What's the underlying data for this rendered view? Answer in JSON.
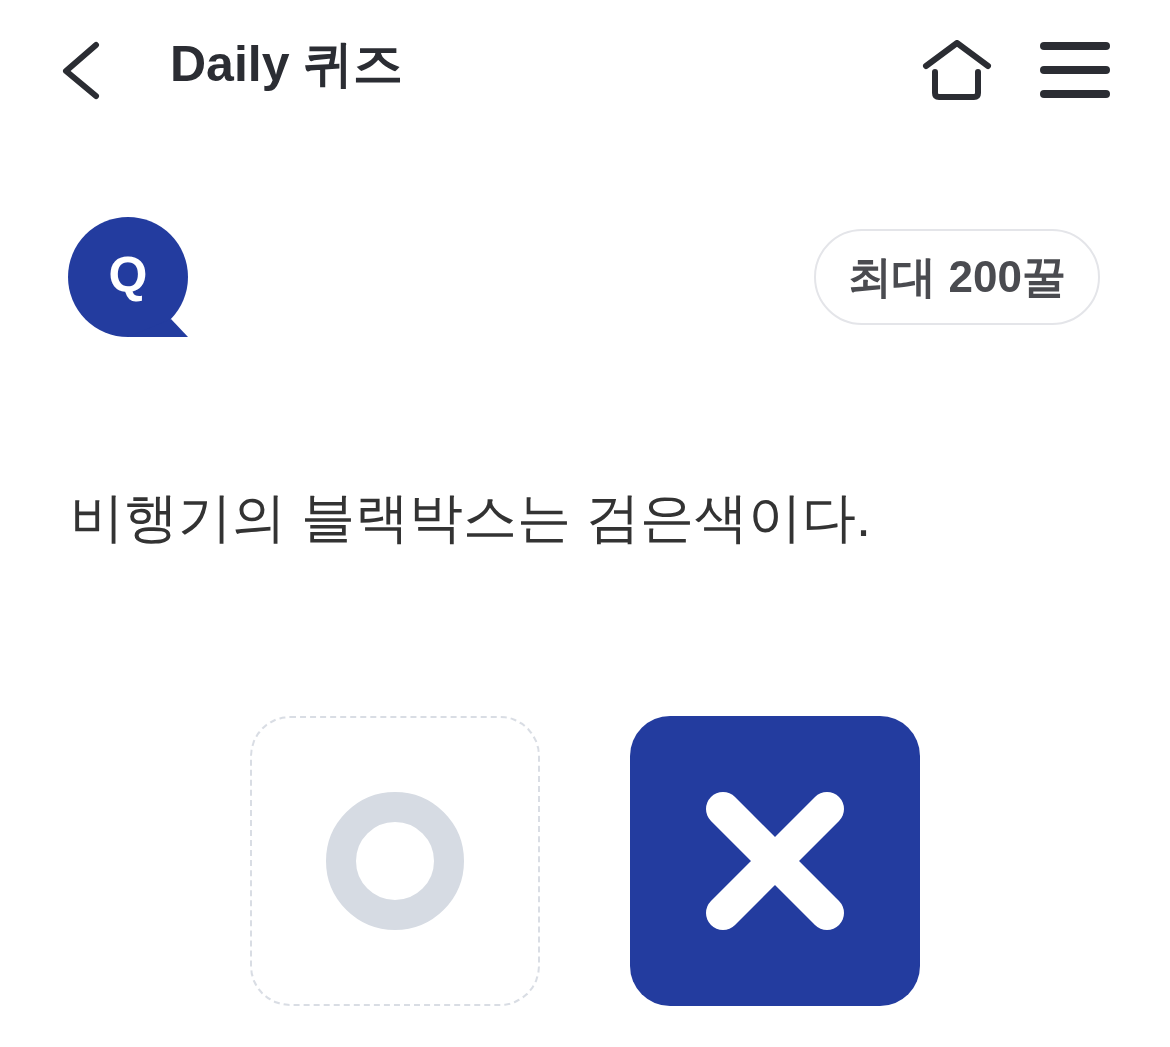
{
  "header": {
    "title": "Daily 퀴즈"
  },
  "quiz": {
    "badge_letter": "Q",
    "reward": "최대 200꿀",
    "question": "비행기의 블랙박스는 검은색이다."
  },
  "answers": [
    {
      "kind": "o",
      "selected": false
    },
    {
      "kind": "x",
      "selected": true
    }
  ]
}
